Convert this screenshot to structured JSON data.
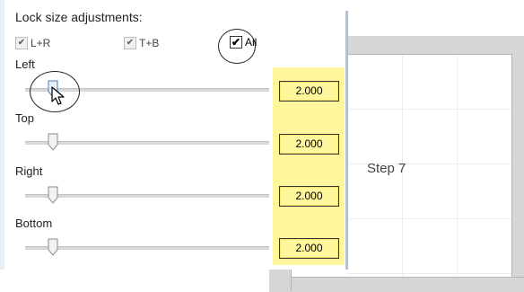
{
  "heading": "Lock size adjustments:",
  "checks": [
    {
      "label": "L+R",
      "checked": true
    },
    {
      "label": "T+B",
      "checked": true
    },
    {
      "label": "All",
      "checked": true
    }
  ],
  "sliders": [
    {
      "label": "Left",
      "value": "2.000"
    },
    {
      "label": "Top",
      "value": "2.000"
    },
    {
      "label": "Right",
      "value": "2.000"
    },
    {
      "label": "Bottom",
      "value": "2.000"
    }
  ],
  "step_label": "Step 7",
  "colors": {
    "highlight": "#fef69a",
    "panel_border": "#a9c3dc",
    "ruler": "#d6d6d6"
  },
  "icons": [
    "check-icon",
    "slider-thumb-icon",
    "cursor-arrow-icon"
  ]
}
